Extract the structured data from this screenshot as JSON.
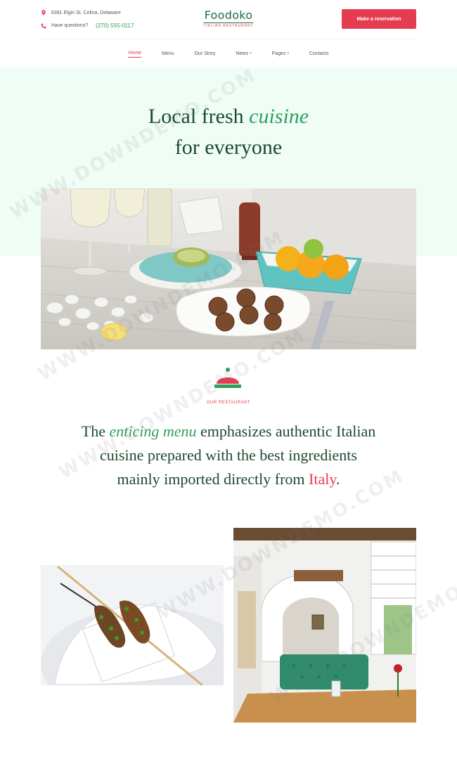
{
  "header": {
    "address": "6391 Elgin St. Celina, Delaware",
    "phone_label": "Have questions?",
    "phone": "(270) 555-0117",
    "logo_name": "Foodoko",
    "logo_tagline": "ITALIAN RESTAURANT",
    "reserve_label": "Make a reservation"
  },
  "nav": {
    "items": [
      {
        "label": "Home",
        "active": true
      },
      {
        "label": "Menu"
      },
      {
        "label": "Our Story"
      },
      {
        "label": "News",
        "dropdown": true
      },
      {
        "label": "Pages",
        "dropdown": true
      },
      {
        "label": "Contacts"
      }
    ]
  },
  "hero": {
    "line1_a": "Local fresh",
    "line1_accent": "cuisine",
    "line2": "for everyone"
  },
  "section": {
    "eyebrow": "OUR RESTAURANT",
    "text_a": "The",
    "text_accent": "enticing menu",
    "text_b": "emphasizes authentic Italian cuisine prepared with the best ingredients mainly imported directly from",
    "text_red": "Italy",
    "text_end": "."
  },
  "watermark": "WWW.DOWNDEMO.COM",
  "colors": {
    "accent_red": "#e43d4f",
    "brand_green": "#2e9e5e",
    "dark_green": "#1b4a2f",
    "hero_bg": "#effdf6"
  }
}
